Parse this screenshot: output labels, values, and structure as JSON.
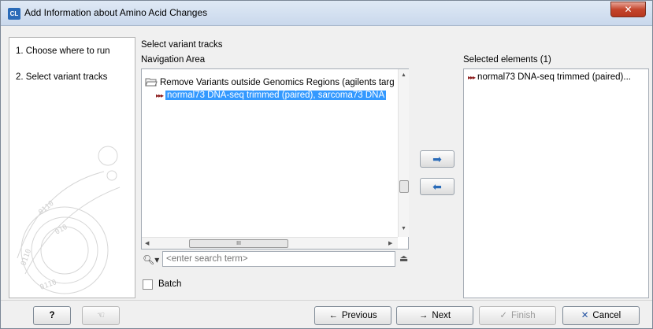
{
  "window": {
    "title": "Add Information about Amino Acid Changes",
    "app_icon_text": "CL",
    "close_glyph": "✕"
  },
  "steps": [
    {
      "label": "1.  Choose where to run"
    },
    {
      "label": "2.  Select variant tracks"
    }
  ],
  "main": {
    "section_title": "Select variant tracks",
    "nav_area_label": "Navigation Area",
    "tree": {
      "folder_label": "Remove Variants outside Genomics Regions (agilents targ",
      "selected_item": "normal73 DNA-seq trimmed (paired), sarcoma73 DNA"
    },
    "hscroll_grip": "III",
    "search": {
      "placeholder": "<enter search term>",
      "value": ""
    },
    "batch_label": "Batch"
  },
  "arrows": {
    "add_glyph": "➡",
    "remove_glyph": "⬅"
  },
  "selected": {
    "header": "Selected elements (1)",
    "items": [
      "normal73 DNA-seq trimmed (paired)..."
    ]
  },
  "footer": {
    "help_label": "?",
    "previous_label": "Previous",
    "next_label": "Next",
    "finish_label": "Finish",
    "cancel_label": "Cancel"
  },
  "colors": {
    "selection": "#3399ff",
    "accent": "#2a6bb8",
    "track_icon": "#8b1a1a"
  }
}
